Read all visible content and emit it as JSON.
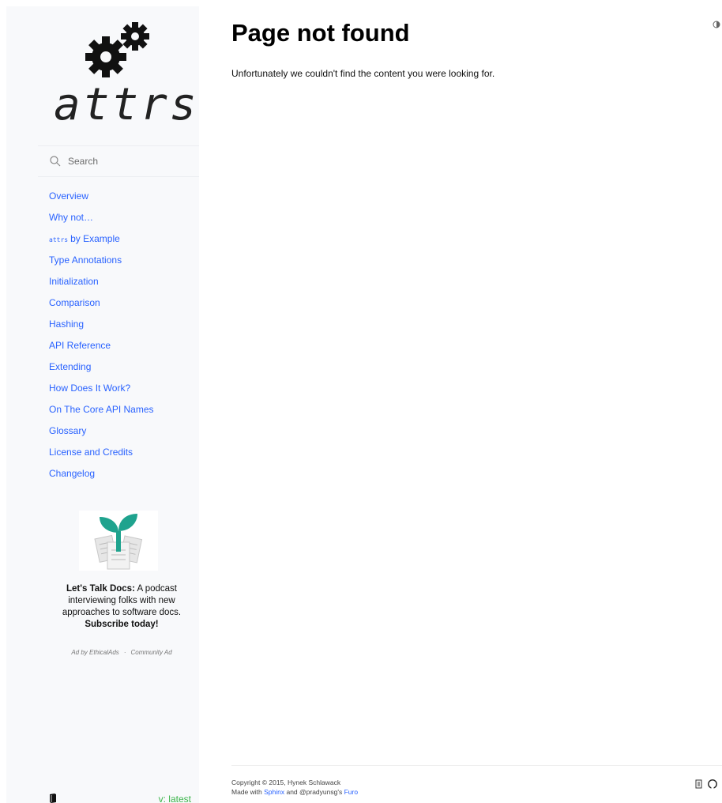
{
  "sidebar": {
    "logo_text": "attrs",
    "search_placeholder": "Search",
    "nav": [
      {
        "label": "Overview"
      },
      {
        "label": "Why not…"
      },
      {
        "code": "attrs",
        "label": "by Example"
      },
      {
        "label": "Type Annotations"
      },
      {
        "label": "Initialization"
      },
      {
        "label": "Comparison"
      },
      {
        "label": "Hashing"
      },
      {
        "label": "API Reference"
      },
      {
        "label": "Extending"
      },
      {
        "label": "How Does It Work?"
      },
      {
        "label": "On The Core API Names"
      },
      {
        "label": "Glossary"
      },
      {
        "label": "License and Credits"
      },
      {
        "label": "Changelog"
      }
    ],
    "ad": {
      "title": "Let's Talk Docs:",
      "body": " A podcast interviewing folks with new approaches to software docs. ",
      "cta": "Subscribe today!",
      "by": "Ad by EthicalAds",
      "separator": "·",
      "community": "Community Ad"
    },
    "version": "v: latest"
  },
  "main": {
    "title": "Page not found",
    "message": "Unfortunately we couldn't find the content you were looking for."
  },
  "footer": {
    "copyright": "Copyright © 2015, Hynek Schlawack",
    "made_with": "Made with ",
    "sphinx": "Sphinx",
    "and_text": " and @pradyunsg's ",
    "furo": "Furo"
  },
  "colors": {
    "link": "#2962ff",
    "version": "#3bb54a",
    "sidebar_bg": "#f8f9fb"
  },
  "icons": [
    "gears-logo",
    "search-icon",
    "book-icon",
    "theme-toggle-icon",
    "edit-icon",
    "github-icon"
  ]
}
